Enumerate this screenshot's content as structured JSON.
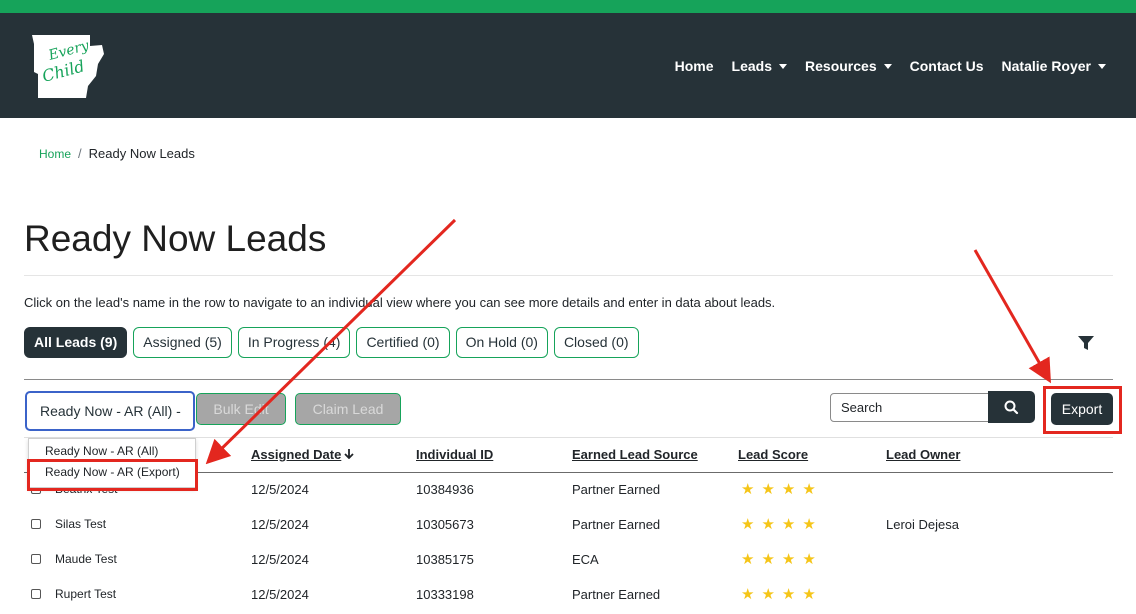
{
  "brand": {
    "logo_text": "Every Child",
    "accent": "#16a35a",
    "nav_bg": "#263238"
  },
  "nav": {
    "items": [
      {
        "label": "Home",
        "dropdown": false
      },
      {
        "label": "Leads",
        "dropdown": true
      },
      {
        "label": "Resources",
        "dropdown": true
      },
      {
        "label": "Contact Us",
        "dropdown": false
      },
      {
        "label": "Natalie Royer",
        "dropdown": true
      }
    ]
  },
  "breadcrumb": {
    "home": "Home",
    "separator": "/",
    "current": "Ready Now Leads"
  },
  "page": {
    "title": "Ready Now Leads",
    "intro": "Click on the lead's name in the row to navigate to an individual view where you can see more details and enter in data about leads."
  },
  "tabs": [
    {
      "label": "All Leads (9)",
      "active": true
    },
    {
      "label": "Assigned (5)",
      "active": false
    },
    {
      "label": "In Progress (4)",
      "active": false
    },
    {
      "label": "Certified (0)",
      "active": false
    },
    {
      "label": "On Hold (0)",
      "active": false
    },
    {
      "label": "Closed (0)",
      "active": false
    }
  ],
  "toolbar": {
    "select_value": "Ready Now - AR (All) -",
    "select_options": [
      "Ready Now - AR (All)",
      "Ready Now - AR (Export)"
    ],
    "bulk_edit": "Bulk Edit",
    "claim_lead": "Claim Lead",
    "search_placeholder": "Search",
    "export": "Export"
  },
  "table": {
    "columns": {
      "assigned_date": "Assigned Date",
      "individual_id": "Individual ID",
      "earned_lead_source": "Earned Lead Source",
      "lead_score": "Lead Score",
      "lead_owner": "Lead Owner"
    },
    "rows": [
      {
        "name": "Beatrix Test",
        "assigned_date": "12/5/2024",
        "individual_id": "10384936",
        "source": "Partner Earned",
        "score": 4,
        "owner": ""
      },
      {
        "name": "Silas Test",
        "assigned_date": "12/5/2024",
        "individual_id": "10305673",
        "source": "Partner Earned",
        "score": 4,
        "owner": "Leroi Dejesa"
      },
      {
        "name": "Maude Test",
        "assigned_date": "12/5/2024",
        "individual_id": "10385175",
        "source": "ECA",
        "score": 4,
        "owner": ""
      },
      {
        "name": "Rupert Test",
        "assigned_date": "12/5/2024",
        "individual_id": "10333198",
        "source": "Partner Earned",
        "score": 4,
        "owner": ""
      }
    ]
  }
}
